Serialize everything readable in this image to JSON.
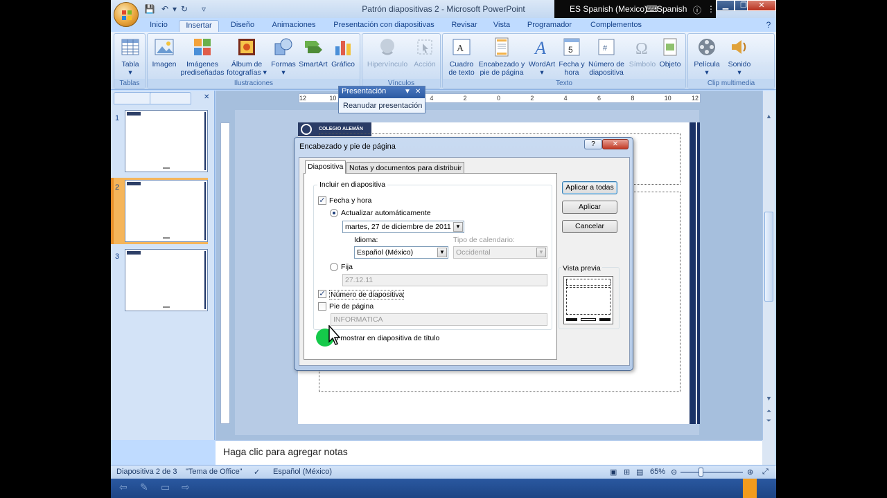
{
  "window": {
    "title": "Patrón diapositivas 2 - Microsoft PowerPoint",
    "lang_indicator": "ES Spanish (Mexico)",
    "lang_name": "Spanish",
    "minimize": "▁",
    "restore": "❐",
    "close": "✕"
  },
  "tabs": [
    "Inicio",
    "Insertar",
    "Diseño",
    "Animaciones",
    "Presentación con diapositivas",
    "Revisar",
    "Vista",
    "Programador",
    "Complementos"
  ],
  "ribbon": {
    "tablas": {
      "label": "Tablas",
      "tabla": "Tabla"
    },
    "ilustraciones": {
      "label": "Ilustraciones",
      "imagen": "Imagen",
      "imagenes_pred": "Imágenes prediseñadas",
      "album": "Álbum de fotografías",
      "formas": "Formas",
      "smartart": "SmartArt",
      "grafico": "Gráfico"
    },
    "vinculos": {
      "label": "Vínculos",
      "hipervinculo": "Hipervínculo",
      "accion": "Acción"
    },
    "texto": {
      "label": "Texto",
      "cuadro": "Cuadro de texto",
      "encabezado": "Encabezado y pie de página",
      "wordart": "WordArt",
      "fecha": "Fecha y hora",
      "numero": "Número de diapositiva",
      "simbolo": "Símbolo",
      "objeto": "Objeto"
    },
    "clip": {
      "label": "Clip multimedia",
      "pelicula": "Película",
      "sonido": "Sonido"
    }
  },
  "slides_panel": {
    "numbers": [
      "1",
      "2",
      "3"
    ],
    "selected": 2
  },
  "slide": {
    "logo_text": "COLEGIO ALEMÁN"
  },
  "ruler": {
    "labels": [
      "12",
      "10",
      "8",
      "6",
      "4",
      "2",
      "0",
      "2",
      "4",
      "6",
      "8",
      "10",
      "12"
    ]
  },
  "presentation_toolbar": {
    "title": "Presentación",
    "item": "Reanudar presentación"
  },
  "dialog": {
    "title": "Encabezado y pie de página",
    "help": "?",
    "close": "✕",
    "tabs": [
      "Diapositiva",
      "Notas y documentos para distribuir"
    ],
    "group_label": "Incluir en diapositiva",
    "fecha_hora": "Fecha y hora",
    "fecha_hora_checked": true,
    "actualizar": "Actualizar automáticamente",
    "fecha_value": "martes, 27 de diciembre de 2011",
    "idioma_label": "Idioma:",
    "idioma_value": "Español (México)",
    "calendario_label": "Tipo de calendario:",
    "calendario_value": "Occidental",
    "fija": "Fija",
    "fija_value": "27.12.11",
    "numero": "Número de diapositiva",
    "numero_checked": true,
    "pie": "Pie de página",
    "pie_value": "INFORMATICA",
    "no_mostrar": "No mostrar en diapositiva de título",
    "btn_aplicar_todas": "Aplicar a todas",
    "btn_aplicar": "Aplicar",
    "btn_cancelar": "Cancelar",
    "vista_previa": "Vista previa"
  },
  "notes": {
    "placeholder": "Haga clic para agregar notas"
  },
  "status": {
    "slide_info": "Diapositiva 2 de 3",
    "theme": "\"Tema de Office\"",
    "language": "Español (México)",
    "zoom": "65%"
  },
  "colors": {
    "ribbon_bg": "#bfdbff",
    "selected_thumb": "#f5b55a",
    "slide_bar": "#1a3266",
    "cursor_highlight": "#15c94a"
  }
}
